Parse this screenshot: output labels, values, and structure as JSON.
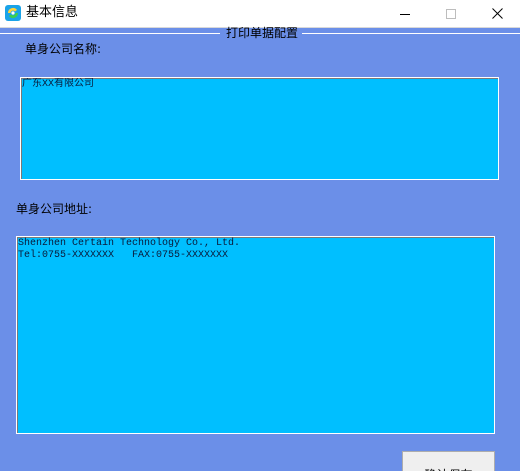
{
  "window": {
    "title": "基本信息",
    "app_icon": "app-icon",
    "controls": {
      "minimize_icon": "minimize-icon",
      "maximize_icon": "maximize-icon",
      "close_icon": "close-icon"
    }
  },
  "print_config": {
    "group_title": "打印单据配置",
    "company_name_label": "单身公司名称:",
    "company_name_value": "广东XX有限公司",
    "company_address_label": "单身公司地址:",
    "company_address_value": "Shenzhen Certain Technology Co., Ltd.\nTel:0755-XXXXXXX   FAX:0755-XXXXXXX",
    "confirm_button_label": "确认保存"
  },
  "colors": {
    "window_background": "#6b8fe8",
    "textbox_background": "#00bfff",
    "titlebar_background": "#ffffff"
  }
}
